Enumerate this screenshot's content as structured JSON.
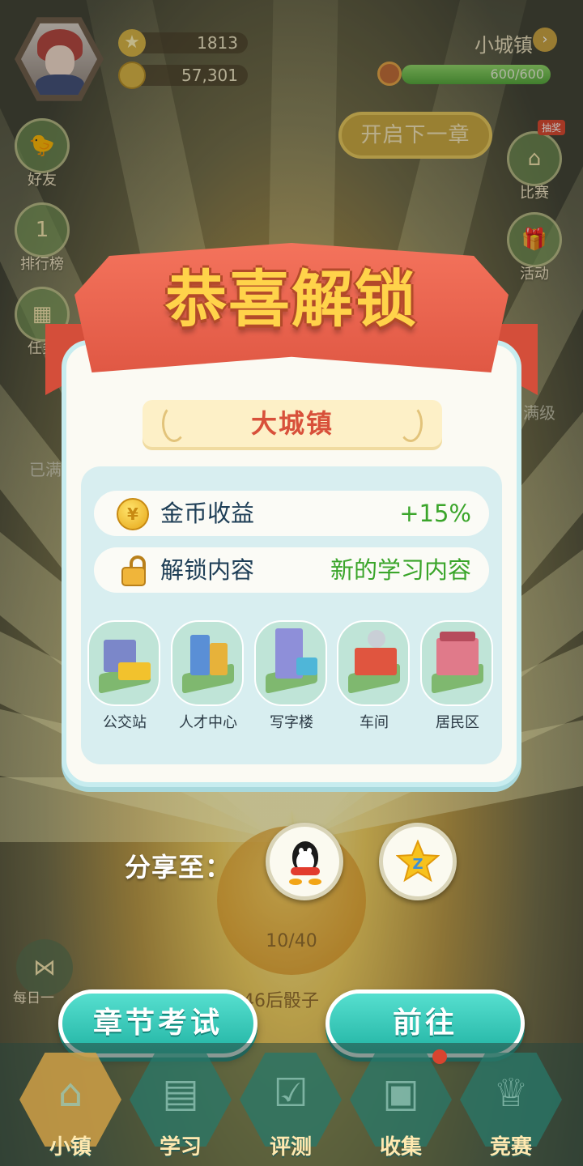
{
  "player": {
    "stars": "1813",
    "coins": "57,301",
    "town": "小城镇",
    "xp_text": "600/600",
    "xp_fraction": 1.0
  },
  "top": {
    "next_chapter": "开启下一章"
  },
  "left_sidebar": [
    {
      "label": "好友",
      "icon": "bird-icon"
    },
    {
      "label": "排行榜",
      "icon": "trophy-icon"
    },
    {
      "label": "任务",
      "icon": "calendar-icon"
    }
  ],
  "right_sidebar": [
    {
      "label": "比赛",
      "badge": "抽奖",
      "icon": "house-icon"
    },
    {
      "label": "活动",
      "icon": "gift-icon"
    }
  ],
  "background_labels": {
    "left": "已满",
    "right": "满级",
    "dice_count": "10/40",
    "dice_hint": "46后骰子",
    "daily": "每日一"
  },
  "modal": {
    "title": "恭喜解锁",
    "town_unlocked": "大城镇",
    "rows": [
      {
        "icon": "coin-icon",
        "label": "金币收益",
        "value": "+15%"
      },
      {
        "icon": "unlock-icon",
        "label": "解锁内容",
        "value": "新的学习内容"
      }
    ],
    "buildings": [
      "公交站",
      "人才中心",
      "写字楼",
      "车间",
      "居民区"
    ]
  },
  "share": {
    "label": "分享至：",
    "targets": [
      "qq-icon",
      "qzone-icon"
    ]
  },
  "buttons": {
    "exam": "章节考试",
    "go": "前往"
  },
  "bottom_nav": [
    {
      "label": "小镇",
      "icon": "house-icon",
      "active": true
    },
    {
      "label": "学习",
      "icon": "books-icon"
    },
    {
      "label": "评测",
      "icon": "checklist-icon"
    },
    {
      "label": "收集",
      "icon": "box-icon",
      "badge": true
    },
    {
      "label": "竞赛",
      "icon": "cup-icon"
    }
  ],
  "colors": {
    "accent_teal": "#22b4a4",
    "ribbon_red": "#e05844",
    "title_yellow": "#ffd34a",
    "positive_green": "#3aa52a"
  }
}
